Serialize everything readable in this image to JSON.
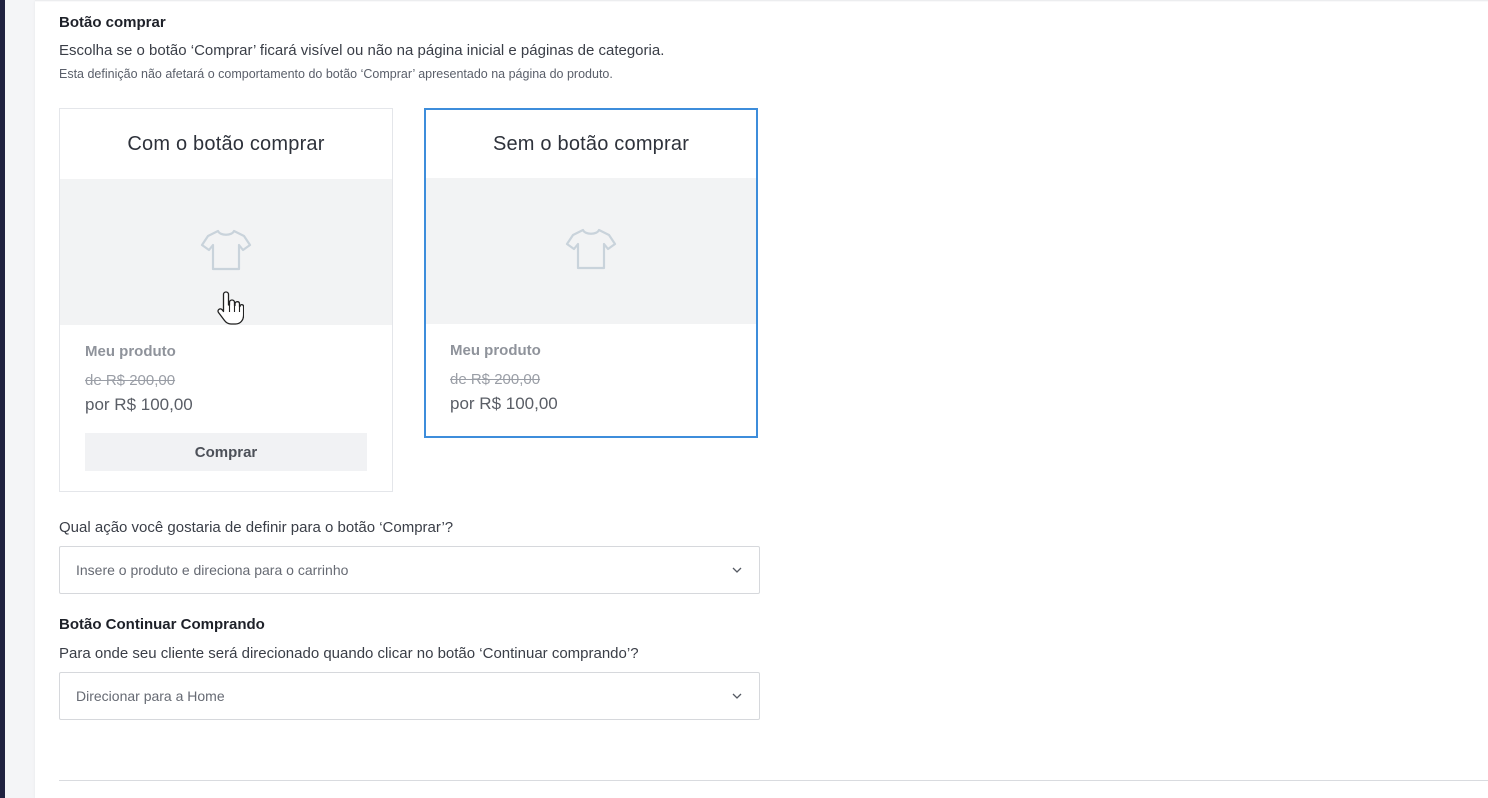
{
  "buy_button_section": {
    "title": "Botão comprar",
    "description": "Escolha se o botão ‘Comprar’ ficará visível ou não na página inicial e páginas de categoria.",
    "note": "Esta definição não afetará o comportamento do botão ‘Comprar’ apresentado na página do produto."
  },
  "options": [
    {
      "title": "Com o botão comprar",
      "product_name": "Meu produto",
      "old_price": "de R$ 200,00",
      "new_price": "por R$ 100,00",
      "button_label": "Comprar",
      "selected": false
    },
    {
      "title": "Sem o botão comprar",
      "product_name": "Meu produto",
      "old_price": "de R$ 200,00",
      "new_price": "por R$ 100,00",
      "selected": true
    }
  ],
  "buy_action": {
    "question": "Qual ação você gostaria de definir para o botão ‘Comprar’?",
    "selected_value": "Insere o produto e direciona para o carrinho"
  },
  "continue_shopping_section": {
    "title": "Botão Continuar Comprando",
    "question": "Para onde seu cliente será direcionado quando clicar no botão ‘Continuar comprando’?",
    "selected_value": "Direcionar para a Home"
  },
  "icons": {
    "product_image": "tshirt-icon",
    "dropdown": "chevron-down-icon",
    "cursor": "hand-pointer-icon"
  },
  "colors": {
    "selected_border": "#3d8ddb",
    "sidebar": "#1f2240",
    "image_placeholder": "#f2f3f4"
  }
}
